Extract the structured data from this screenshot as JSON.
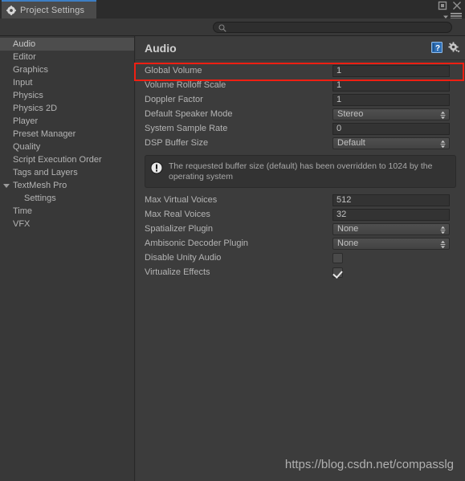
{
  "window": {
    "tab_label": "Project Settings",
    "tab_icon": "gear-icon",
    "maximize_icon": "maximize-icon",
    "close_icon": "close-icon",
    "menu_icon": "hamburger-menu-icon",
    "dropdown_icon": "chevron-down-icon"
  },
  "search": {
    "value": "",
    "placeholder": "",
    "icon": "search-icon"
  },
  "sidebar": {
    "items": [
      {
        "label": "Audio",
        "selected": true,
        "child": false,
        "arrow": "none"
      },
      {
        "label": "Editor",
        "selected": false,
        "child": false,
        "arrow": "none"
      },
      {
        "label": "Graphics",
        "selected": false,
        "child": false,
        "arrow": "none"
      },
      {
        "label": "Input",
        "selected": false,
        "child": false,
        "arrow": "none"
      },
      {
        "label": "Physics",
        "selected": false,
        "child": false,
        "arrow": "none"
      },
      {
        "label": "Physics 2D",
        "selected": false,
        "child": false,
        "arrow": "none"
      },
      {
        "label": "Player",
        "selected": false,
        "child": false,
        "arrow": "none"
      },
      {
        "label": "Preset Manager",
        "selected": false,
        "child": false,
        "arrow": "none"
      },
      {
        "label": "Quality",
        "selected": false,
        "child": false,
        "arrow": "none"
      },
      {
        "label": "Script Execution Order",
        "selected": false,
        "child": false,
        "arrow": "none"
      },
      {
        "label": "Tags and Layers",
        "selected": false,
        "child": false,
        "arrow": "none"
      },
      {
        "label": "TextMesh Pro",
        "selected": false,
        "child": false,
        "arrow": "open"
      },
      {
        "label": "Settings",
        "selected": false,
        "child": true,
        "arrow": "none"
      },
      {
        "label": "Time",
        "selected": false,
        "child": false,
        "arrow": "none"
      },
      {
        "label": "VFX",
        "selected": false,
        "child": false,
        "arrow": "none"
      }
    ]
  },
  "panel": {
    "title": "Audio",
    "help_icon": "help-book-icon",
    "settings_icon": "gear-dropdown-icon",
    "rows": [
      {
        "label": "Global Volume",
        "type": "text",
        "value": "1",
        "highlighted": true
      },
      {
        "label": "Volume Rolloff Scale",
        "type": "text",
        "value": "1",
        "highlighted": false
      },
      {
        "label": "Doppler Factor",
        "type": "text",
        "value": "1",
        "highlighted": false
      },
      {
        "label": "Default Speaker Mode",
        "type": "dropdown",
        "value": "Stereo",
        "highlighted": false
      },
      {
        "label": "System Sample Rate",
        "type": "text",
        "value": "0",
        "highlighted": false
      },
      {
        "label": "DSP Buffer Size",
        "type": "dropdown",
        "value": "Default",
        "highlighted": false
      }
    ],
    "info": {
      "icon": "info-exclamation-icon",
      "text": "The requested buffer size (default) has been overridden to 1024 by the operating system"
    },
    "rows2": [
      {
        "label": "Max Virtual Voices",
        "type": "text",
        "value": "512",
        "highlighted": false
      },
      {
        "label": "Max Real Voices",
        "type": "text",
        "value": "32",
        "highlighted": false
      },
      {
        "label": "Spatializer Plugin",
        "type": "dropdown",
        "value": "None",
        "highlighted": false
      },
      {
        "label": "Ambisonic Decoder Plugin",
        "type": "dropdown",
        "value": "None",
        "highlighted": false
      },
      {
        "label": "Disable Unity Audio",
        "type": "checkbox",
        "value": false,
        "highlighted": false
      },
      {
        "label": "Virtualize Effects",
        "type": "checkbox",
        "value": true,
        "highlighted": false
      }
    ]
  },
  "watermark": "https://blog.csdn.net/compasslg",
  "colors": {
    "tab_accent": "#3d7ec4",
    "highlight": "#f01f12",
    "panel_bg": "#3c3c3c",
    "sidebar_bg": "#383838",
    "selected_row": "#4d4d4d"
  }
}
